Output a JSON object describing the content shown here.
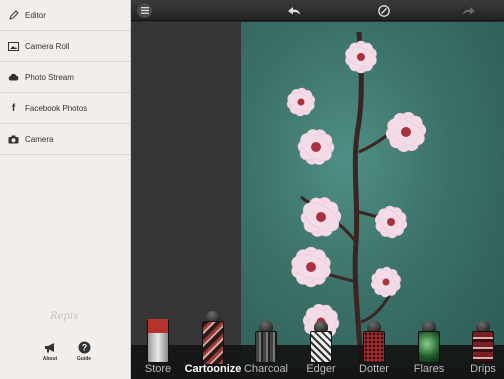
{
  "sidebar": {
    "items": [
      {
        "label": "Editor",
        "icon": "pencil-icon"
      },
      {
        "label": "Camera Roll",
        "icon": "image-icon"
      },
      {
        "label": "Photo Stream",
        "icon": "cloud-icon"
      },
      {
        "label": "Facebook Photos",
        "icon": "facebook-icon"
      },
      {
        "label": "Camera",
        "icon": "camera-icon"
      }
    ],
    "brand": "Repix",
    "footer": {
      "about_label": "About",
      "guide_label": "Guide"
    }
  },
  "toolbar": {
    "menu_icon": "menu-icon",
    "undo_icon": "undo-icon",
    "compare_icon": "compare-icon",
    "redo_icon": "redo-icon"
  },
  "filters": [
    {
      "label": "Store",
      "active": false
    },
    {
      "label": "Cartoonize",
      "active": true
    },
    {
      "label": "Charcoal",
      "active": false
    },
    {
      "label": "Edger",
      "active": false
    },
    {
      "label": "Dotter",
      "active": false
    },
    {
      "label": "Flares",
      "active": false
    },
    {
      "label": "Drips",
      "active": false
    }
  ],
  "colors": {
    "sidebar_bg": "#f2eeeb",
    "photo_bg": "#3b7169",
    "toolbar_bg": "#2b2b2b",
    "active_filter": "#ffffff"
  }
}
